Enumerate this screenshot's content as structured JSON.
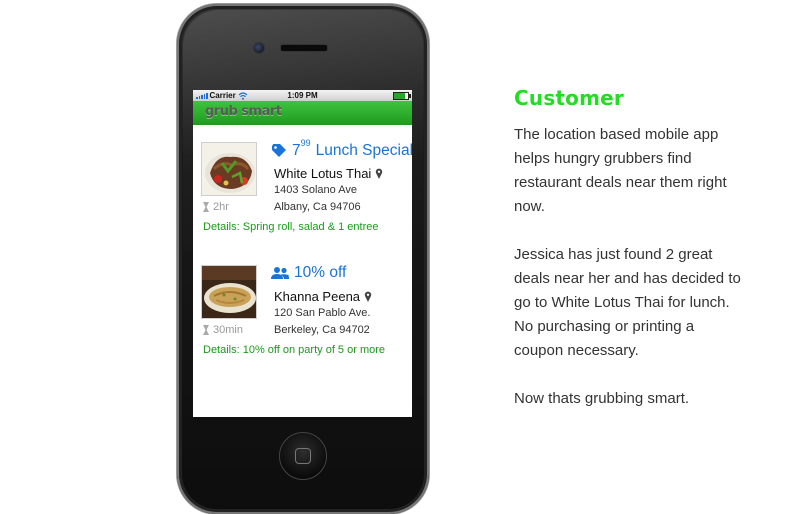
{
  "status_bar": {
    "carrier": "Carrier",
    "time": "1:09 PM"
  },
  "app": {
    "logo": "grub smart"
  },
  "deals": [
    {
      "tag_icon": "price-tag-icon",
      "price_main": "7",
      "price_sup": "99",
      "offer_text": "Lunch Special",
      "restaurant": "White Lotus Thai",
      "address_line1": "1403 Solano Ave",
      "address_line2": "Albany, Ca 94706",
      "time_left": "2hr",
      "details": "Details: Spring roll, salad & 1 entree"
    },
    {
      "tag_icon": "group-icon",
      "offer_text": "10% off",
      "restaurant": "Khanna Peena",
      "address_line1": "120 San Pablo Ave.",
      "address_line2": "Berkeley, Ca 94702",
      "time_left": "30min",
      "details": "Details: 10% off on party of 5 or more"
    }
  ],
  "sidebar": {
    "heading": "Customer",
    "paragraphs": [
      "The location based mobile app helps hungry grubbers find restaurant deals near them right now.",
      "Jessica has just found 2 great deals near her and has decided to go to White Lotus Thai for lunch. No purchasing or printing a coupon necessary.",
      "Now thats grubbing smart."
    ]
  },
  "colors": {
    "accent_green": "#22dd22",
    "app_green": "#2fb02f",
    "link_blue": "#1a73d6",
    "details_green": "#1a9a1a"
  }
}
